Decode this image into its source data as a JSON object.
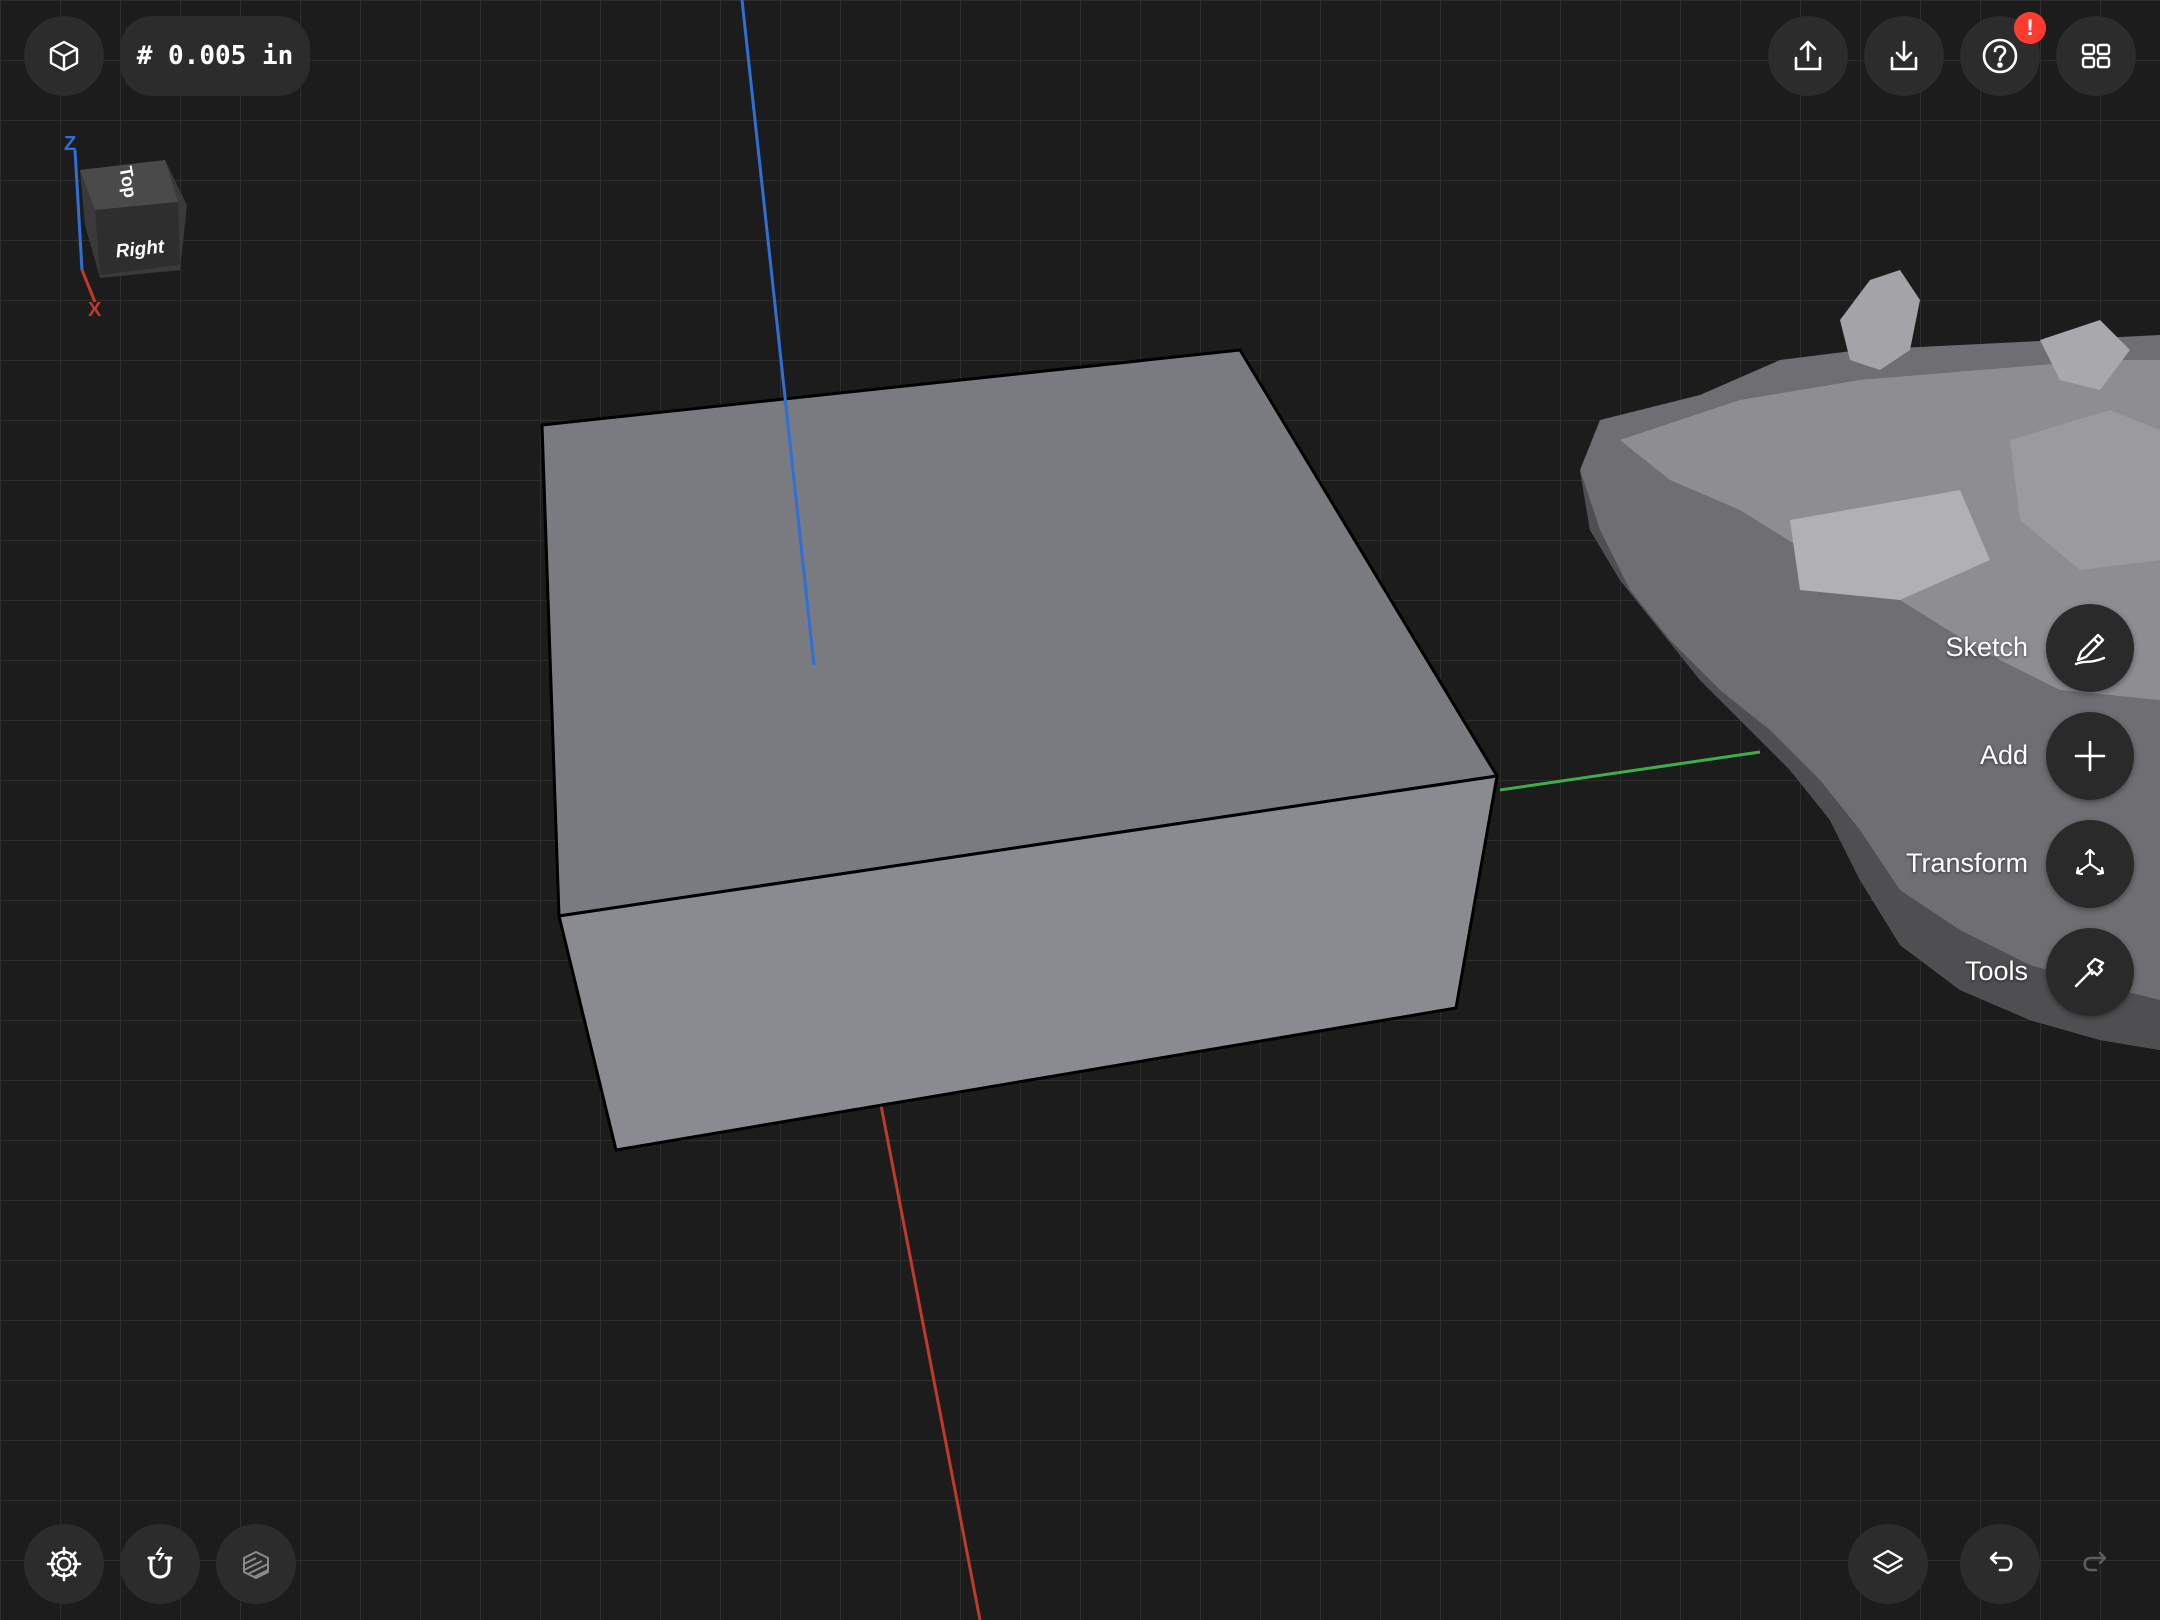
{
  "toolbar": {
    "grid_spacing_label": "# 0.005 in",
    "help_badge": "!"
  },
  "view_cube": {
    "top_face": "Top",
    "right_face": "Right",
    "axis_z": "Z",
    "axis_x": "X"
  },
  "side_menu": {
    "items": [
      {
        "label": "Sketch",
        "icon": "pencil-icon"
      },
      {
        "label": "Add",
        "icon": "plus-icon"
      },
      {
        "label": "Transform",
        "icon": "transform-arrows-icon"
      },
      {
        "label": "Tools",
        "icon": "hammer-icon"
      }
    ]
  },
  "colors": {
    "background": "#1c1c1c",
    "grid_line": "#2f2f2f",
    "axis_x": "#c0392b",
    "axis_y": "#3fae4a",
    "axis_z": "#2f6fd6",
    "box_top": "#7a7b80",
    "box_front": "#8a8b90",
    "button_bg": "#2c2c2c",
    "alert": "#ff3b30"
  }
}
